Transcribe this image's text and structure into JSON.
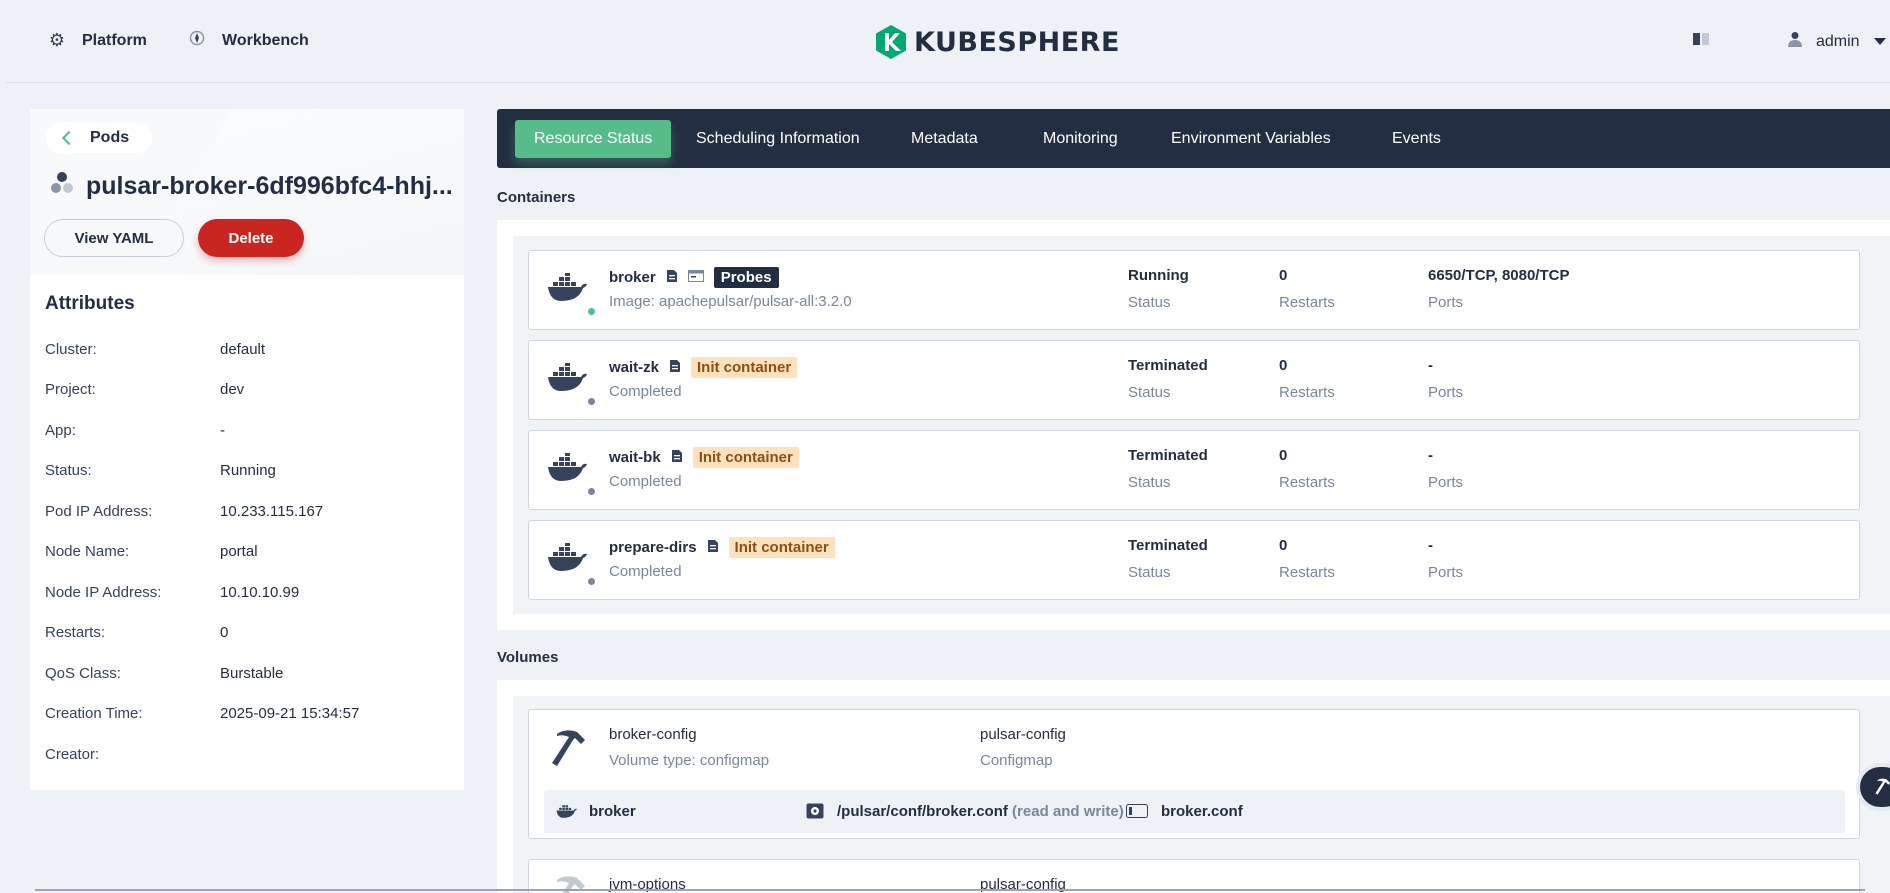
{
  "topbar": {
    "platform": "Platform",
    "workbench": "Workbench",
    "brand": "KUBESPHERE",
    "user": "admin"
  },
  "pod": {
    "back_label": "Pods",
    "title": "pulsar-broker-6df996bfc4-hhj...",
    "view_yaml": "View YAML",
    "delete": "Delete"
  },
  "attributes": {
    "title": "Attributes",
    "rows": [
      {
        "k": "Cluster:",
        "v": "default"
      },
      {
        "k": "Project:",
        "v": "dev"
      },
      {
        "k": "App:",
        "v": "-"
      },
      {
        "k": "Status:",
        "v": "Running"
      },
      {
        "k": "Pod IP Address:",
        "v": "10.233.115.167"
      },
      {
        "k": "Node Name:",
        "v": "portal"
      },
      {
        "k": "Node IP Address:",
        "v": "10.10.10.99"
      },
      {
        "k": "Restarts:",
        "v": "0"
      },
      {
        "k": "QoS Class:",
        "v": "Burstable"
      },
      {
        "k": "Creation Time:",
        "v": "2025-09-21 15:34:57"
      },
      {
        "k": "Creator:",
        "v": ""
      }
    ]
  },
  "tabs": [
    "Resource Status",
    "Scheduling Information",
    "Metadata",
    "Monitoring",
    "Environment Variables",
    "Events"
  ],
  "containers": {
    "title": "Containers",
    "items": [
      {
        "name": "broker",
        "badge": "Probes",
        "sub": "Image: apachepulsar/pulsar-all:3.2.0",
        "status": "Running",
        "status_label": "Status",
        "restarts": "0",
        "restarts_label": "Restarts",
        "ports": "6650/TCP, 8080/TCP",
        "ports_label": "Ports",
        "dot": "#55bc8a"
      },
      {
        "name": "wait-zk",
        "badge": "Init container",
        "sub": "Completed",
        "status": "Terminated",
        "status_label": "Status",
        "restarts": "0",
        "restarts_label": "Restarts",
        "ports": "-",
        "ports_label": "Ports",
        "dot": "#79879c"
      },
      {
        "name": "wait-bk",
        "badge": "Init container",
        "sub": "Completed",
        "status": "Terminated",
        "status_label": "Status",
        "restarts": "0",
        "restarts_label": "Restarts",
        "ports": "-",
        "ports_label": "Ports",
        "dot": "#79879c"
      },
      {
        "name": "prepare-dirs",
        "badge": "Init container",
        "sub": "Completed",
        "status": "Terminated",
        "status_label": "Status",
        "restarts": "0",
        "restarts_label": "Restarts",
        "ports": "-",
        "ports_label": "Ports",
        "dot": "#79879c"
      }
    ]
  },
  "volumes": {
    "title": "Volumes",
    "items": [
      {
        "name": "broker-config",
        "type": "Volume type: configmap",
        "source": "pulsar-config",
        "source_type": "Configmap",
        "mount_container": "broker",
        "mount_path": "/pulsar/conf/broker.conf",
        "mount_mode": "(read and write)",
        "sub_path": "broker.conf"
      },
      {
        "name": "jvm-options",
        "source": "pulsar-config"
      }
    ]
  },
  "colors": {
    "accent": "#55bc8a",
    "dark": "#242e42",
    "danger": "#ca2621"
  }
}
